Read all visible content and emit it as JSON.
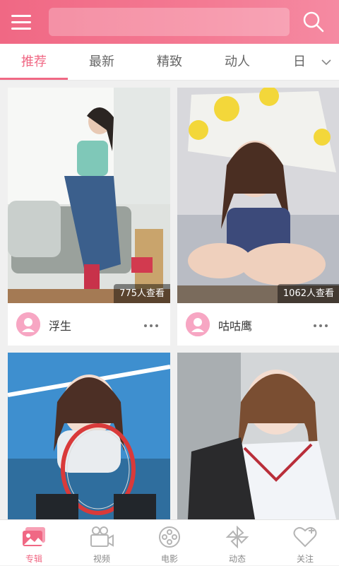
{
  "header": {
    "search_placeholder": ""
  },
  "tabs": [
    {
      "label": "推荐",
      "active": true
    },
    {
      "label": "最新",
      "active": false
    },
    {
      "label": "精致",
      "active": false
    },
    {
      "label": "动人",
      "active": false
    },
    {
      "label": "日",
      "active": false
    }
  ],
  "cards": [
    {
      "views": "775人查看",
      "user": "浮生"
    },
    {
      "views": "1062人查看",
      "user": "咕咕鹰"
    },
    {
      "views": "",
      "user": ""
    },
    {
      "views": "",
      "user": ""
    }
  ],
  "bottom_nav": [
    {
      "label": "专辑",
      "icon": "album-icon",
      "active": true
    },
    {
      "label": "视频",
      "icon": "video-camera-icon",
      "active": false
    },
    {
      "label": "电影",
      "icon": "film-reel-icon",
      "active": false
    },
    {
      "label": "动态",
      "icon": "pinwheel-icon",
      "active": false
    },
    {
      "label": "关注",
      "icon": "heart-plus-icon",
      "active": false
    }
  ],
  "colors": {
    "accent": "#f06884",
    "inactive": "#8a8a8a"
  }
}
